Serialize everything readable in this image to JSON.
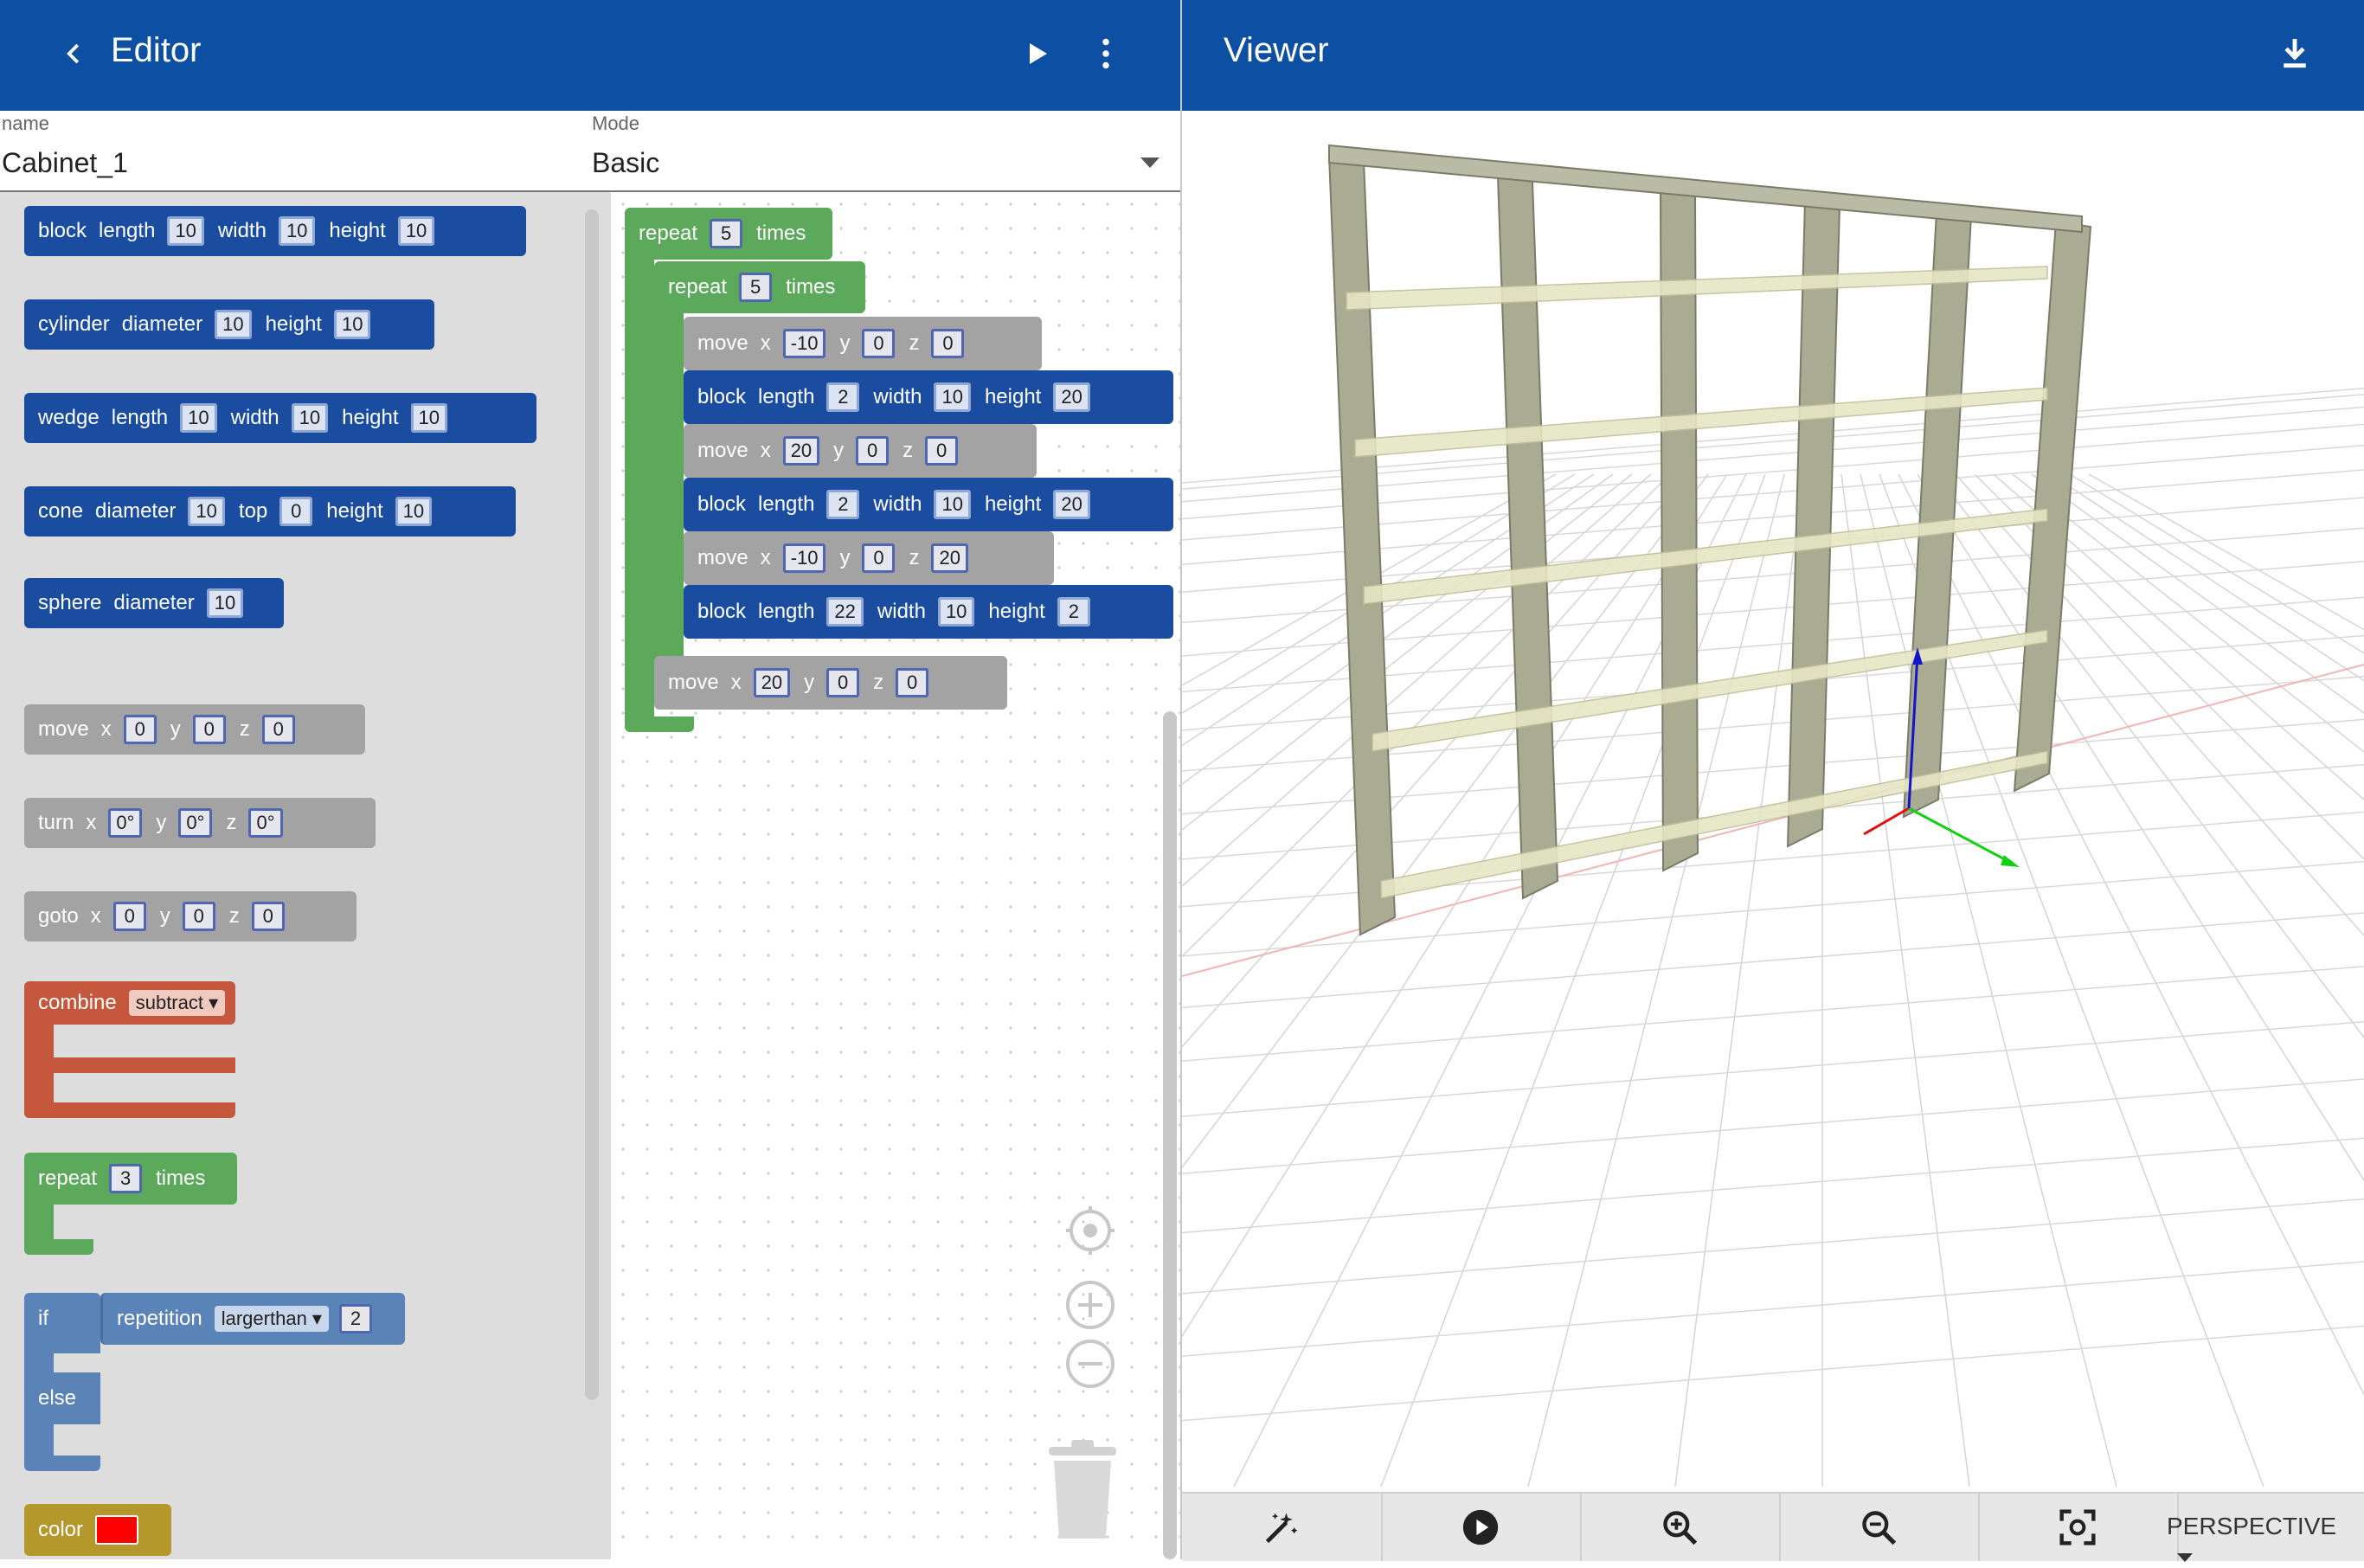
{
  "editor": {
    "title": "Editor",
    "back_icon": "chevron-left-icon",
    "run_icon": "play-icon",
    "menu_icon": "more-vert-icon"
  },
  "viewer": {
    "title": "Viewer",
    "download_icon": "download-icon"
  },
  "form": {
    "name_label": "name",
    "name_value": "Cabinet_1",
    "mode_label": "Mode",
    "mode_value": "Basic"
  },
  "toolbox": {
    "block": [
      "block",
      "length",
      "10",
      "width",
      "10",
      "height",
      "10"
    ],
    "cylinder": [
      "cylinder",
      "diameter",
      "10",
      "height",
      "10"
    ],
    "wedge": [
      "wedge",
      "length",
      "10",
      "width",
      "10",
      "height",
      "10"
    ],
    "cone": [
      "cone",
      "diameter",
      "10",
      "top",
      "0",
      "height",
      "10"
    ],
    "sphere": [
      "sphere",
      "diameter",
      "10"
    ],
    "move": [
      "move",
      "x",
      "0",
      "y",
      "0",
      "z",
      "0"
    ],
    "turn": [
      "turn",
      "x",
      "0°",
      "y",
      "0°",
      "z",
      "0°"
    ],
    "goto": [
      "goto",
      "x",
      "0",
      "y",
      "0",
      "z",
      "0"
    ],
    "combine": [
      "combine",
      "subtract"
    ],
    "repeat": [
      "repeat",
      "3",
      "times"
    ],
    "if": [
      "if",
      "repetition",
      "largerthan",
      "2",
      "else"
    ],
    "color": [
      "color"
    ]
  },
  "program": {
    "outer_repeat": [
      "repeat",
      "5",
      "times"
    ],
    "inner_repeat": [
      "repeat",
      "5",
      "times"
    ],
    "move1": [
      "move",
      "x",
      "-10",
      "y",
      "0",
      "z",
      "0"
    ],
    "block1": [
      "block",
      "length",
      "2",
      "width",
      "10",
      "height",
      "20"
    ],
    "move2": [
      "move",
      "x",
      "20",
      "y",
      "0",
      "z",
      "0"
    ],
    "block2": [
      "block",
      "length",
      "2",
      "width",
      "10",
      "height",
      "20"
    ],
    "move3": [
      "move",
      "x",
      "-10",
      "y",
      "0",
      "z",
      "20"
    ],
    "block3": [
      "block",
      "length",
      "22",
      "width",
      "10",
      "height",
      "2"
    ],
    "move4": [
      "move",
      "x",
      "20",
      "y",
      "0",
      "z",
      "0"
    ]
  },
  "viewer_toolbar": {
    "icons": [
      "magic-wand-icon",
      "play-circle-icon",
      "zoom-in-icon",
      "zoom-out-icon",
      "focus-icon"
    ],
    "projection": "PERSPECTIVE"
  },
  "colors": {
    "header": "#0d4fa3",
    "block": "#1a4d9f",
    "control": "#5ca95b",
    "transform": "#a3a3a3",
    "combine": "#c4573c",
    "color_swatch": "#ff0000"
  }
}
